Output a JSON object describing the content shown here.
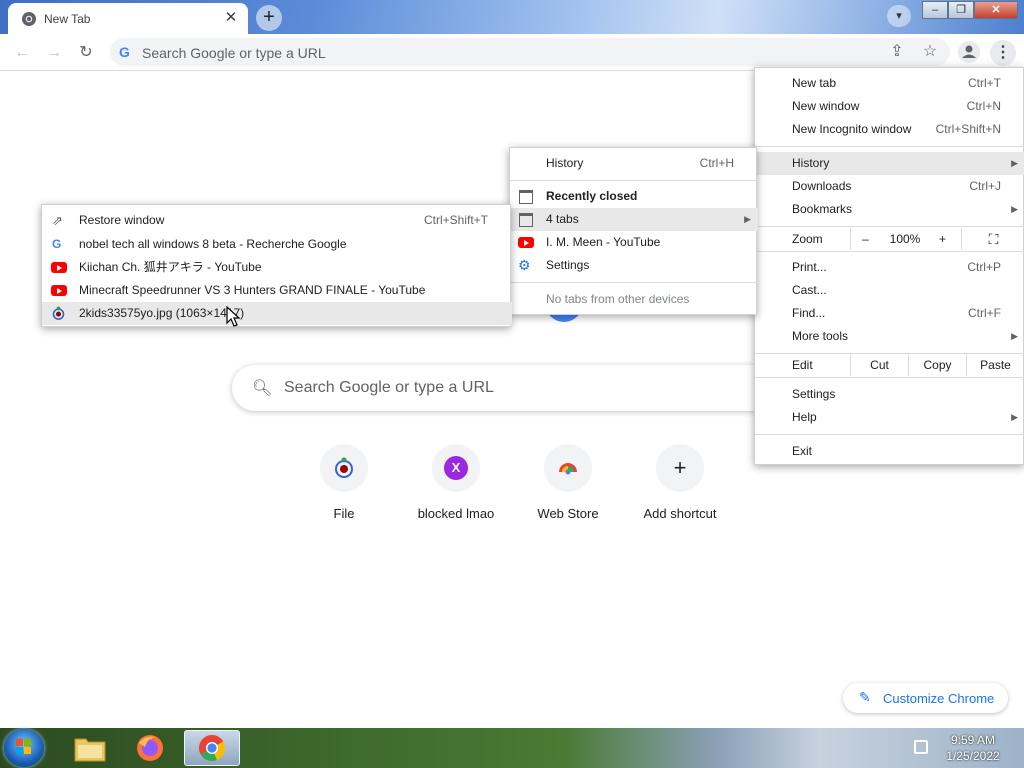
{
  "tab": {
    "title": "New Tab",
    "close": "✕"
  },
  "toolbar": {
    "omnibox_g": "G",
    "omnibox_placeholder": "Search Google or type a URL"
  },
  "ntp": {
    "search_placeholder": "Search Google or type a URL",
    "shortcuts": [
      {
        "label": "File"
      },
      {
        "label": "blocked lmao",
        "letter": "X"
      },
      {
        "label": "Web Store"
      },
      {
        "label": "Add shortcut",
        "glyph": "+"
      }
    ],
    "customize_label": "Customize Chrome"
  },
  "main_menu": {
    "new_tab": {
      "label": "New tab",
      "shortcut": "Ctrl+T"
    },
    "new_window": {
      "label": "New window",
      "shortcut": "Ctrl+N"
    },
    "new_incognito": {
      "label": "New Incognito window",
      "shortcut": "Ctrl+Shift+N"
    },
    "history": {
      "label": "History"
    },
    "downloads": {
      "label": "Downloads",
      "shortcut": "Ctrl+J"
    },
    "bookmarks": {
      "label": "Bookmarks"
    },
    "zoom": {
      "label": "Zoom",
      "minus": "–",
      "value": "100%",
      "plus": "+"
    },
    "print": {
      "label": "Print...",
      "shortcut": "Ctrl+P"
    },
    "cast": {
      "label": "Cast..."
    },
    "find": {
      "label": "Find...",
      "shortcut": "Ctrl+F"
    },
    "more_tools": {
      "label": "More tools"
    },
    "edit": {
      "label": "Edit",
      "cut": "Cut",
      "copy": "Copy",
      "paste": "Paste"
    },
    "settings": {
      "label": "Settings"
    },
    "help": {
      "label": "Help"
    },
    "exit": {
      "label": "Exit"
    }
  },
  "history_menu": {
    "history": {
      "label": "History",
      "shortcut": "Ctrl+H"
    },
    "recently_closed": "Recently closed",
    "four_tabs": "4 tabs",
    "im_meen": "I. M. Meen - YouTube",
    "settings": "Settings",
    "no_tabs": "No tabs from other devices"
  },
  "tabs_menu": {
    "restore": {
      "label": "Restore window",
      "shortcut": "Ctrl+Shift+T"
    },
    "items": [
      "nobel tech all windows 8 beta - Recherche Google",
      "Kiichan Ch. 狐井アキラ - YouTube",
      "Minecraft Speedrunner VS 3 Hunters GRAND FINALE - YouTube",
      "2kids33575yo.jpg (1063×1417)"
    ]
  },
  "taskbar": {
    "time": "9:59 AM",
    "date": "1/25/2022"
  },
  "colors": {
    "accent": "#1a73e8",
    "youtube": "#ff0000",
    "google_blue": "#4285f4"
  }
}
